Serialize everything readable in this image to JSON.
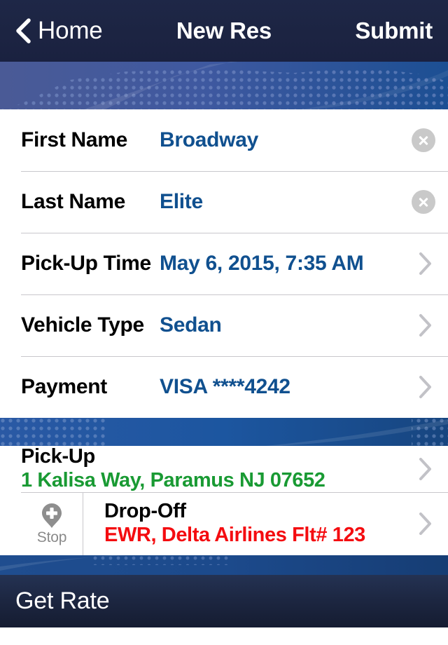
{
  "navbar": {
    "back_label": "Home",
    "back_icon": "chevron-left-icon",
    "title": "New Res",
    "submit_label": "Submit"
  },
  "form": {
    "rows": [
      {
        "label": "First Name",
        "value": "Broadway",
        "accessory": "clear"
      },
      {
        "label": "Last Name",
        "value": "Elite",
        "accessory": "clear"
      },
      {
        "label": "Pick-Up Time",
        "value": "May 6, 2015, 7:35 AM",
        "accessory": "chevron"
      },
      {
        "label": "Vehicle Type",
        "value": "Sedan",
        "accessory": "chevron"
      },
      {
        "label": "Payment",
        "value": "VISA ****4242",
        "accessory": "chevron"
      }
    ]
  },
  "locations": {
    "pickup": {
      "title": "Pick-Up",
      "address": "1 Kalisa Way, Paramus NJ 07652"
    },
    "dropoff": {
      "stop_label": "Stop",
      "stop_icon": "map-pin-plus-icon",
      "title": "Drop-Off",
      "address": "EWR, Delta Airlines Flt# 123"
    }
  },
  "bottom_bar": {
    "label": "Get Rate"
  },
  "colors": {
    "nav_background": "#1c2442",
    "value_blue": "#10508f",
    "pickup_green": "#199a33",
    "dropoff_red": "#f40c10",
    "banner_blue": "#1c56a0",
    "separator": "#c8c7cc"
  }
}
